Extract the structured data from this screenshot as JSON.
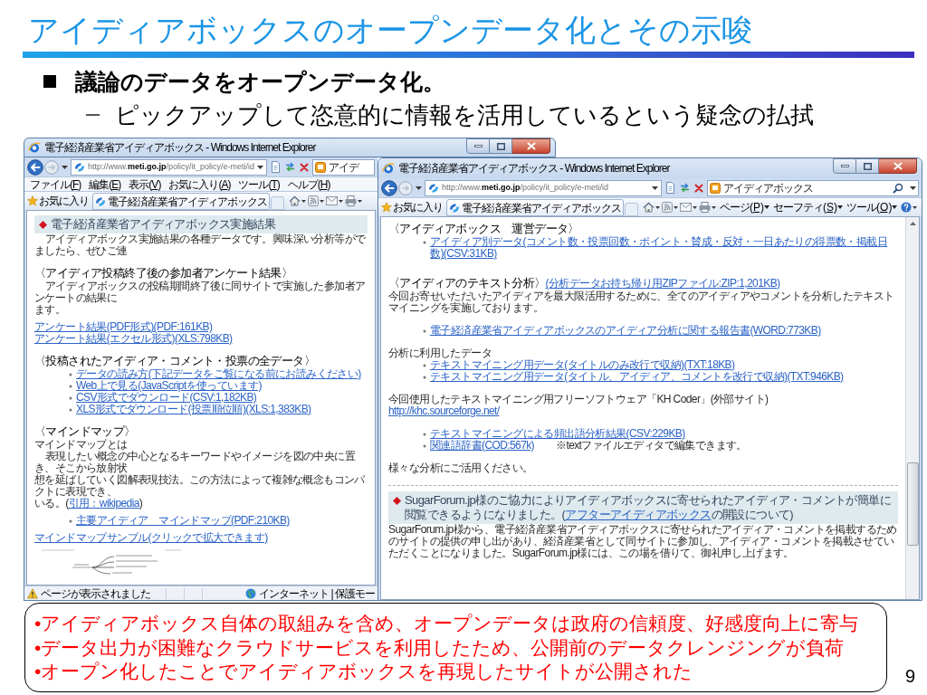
{
  "slide": {
    "title": "アイディアボックスのオープンデータ化とその示唆",
    "bullets": [
      {
        "text": "議論のデータをオープンデータ化。",
        "children": [
          {
            "text": "ピックアップして恣意的に情報を活用しているという疑念の払拭"
          }
        ]
      }
    ],
    "page_number": "9"
  },
  "screenshots": [
    {
      "partly_covered": true,
      "title": "電子経済産業省アイディアボックス - Windows Internet Explorer",
      "address": {
        "url": "http://www.**meti.go.jp**/policy/it_policy/e-meti/id"
      },
      "search": {
        "value": "アイデ"
      },
      "menu": [
        "ファイル(F)",
        "編集(E)",
        "表示(V)",
        "お気に入り(A)",
        "ツール(T)",
        "ヘルプ(H)"
      ],
      "favorites": {
        "label": "お気に入り"
      },
      "tabs": [
        {
          "label": "電子経済産業省アイディアボックス",
          "selected": true
        }
      ],
      "sections": [
        {
          "lines": [
            {
              "kind": "banner",
              "text": "電子経済産業省アイディアボックス実施結果"
            },
            {
              "kind": "text",
              "indent": true,
              "text": "アイディアボックス実施結果の各種データです。興味深い分析等がでましたら、ぜひご連"
            }
          ]
        },
        {
          "lines": [
            {
              "kind": "heading",
              "text": "〈アイディア投稿終了後の参加者アンケート結果〉"
            },
            {
              "kind": "text",
              "indent": true,
              "text": "アイディアボックスの投稿期間終了後に同サイトで実施した参加者アンケートの結果に"
            },
            {
              "kind": "text",
              "indent": false,
              "text": "ます。"
            }
          ]
        },
        {
          "lines": [
            {
              "kind": "link",
              "text": "アンケート結果(PDF形式)(PDF:161KB)"
            },
            {
              "kind": "link",
              "text": "アンケート結果(エクセル形式)(XLS:798KB)"
            }
          ]
        },
        {
          "lines": [
            {
              "kind": "heading",
              "text": "〈投稿されたアイディア・コメント・投票の全データ〉"
            },
            {
              "kind": "bullet_link",
              "text": "データの読み方(下記データをご覧になる前にお読みください)"
            },
            {
              "kind": "bullet_link",
              "text": "Web上で見る(JavaScriptを使っています)"
            },
            {
              "kind": "bullet_link",
              "text": "CSV形式でダウンロード(CSV:1,182KB)"
            },
            {
              "kind": "bullet_link",
              "text": "XLS形式でダウンロード(投票順位順)(XLS:1,383KB)"
            }
          ]
        },
        {
          "lines": [
            {
              "kind": "heading",
              "text": "〈マインドマップ〉"
            },
            {
              "kind": "text",
              "indent": false,
              "text": "マインドマップとは"
            },
            {
              "kind": "text",
              "indent": true,
              "text": "表現したい概念の中心となるキーワードやイメージを図の中央に置き、そこから放射状"
            },
            {
              "kind": "text",
              "indent": false,
              "text": "想を延ばしていく図解表現技法。この方法によって複雑な概念もコンパクトに表現でき、"
            },
            {
              "kind": "text",
              "indent": false,
              "text": "いる。(",
              "link": "引用：wikipedia",
              "text_after": ")"
            }
          ]
        },
        {
          "lines": [
            {
              "kind": "bullet_link",
              "text": "主要アイディア　マインドマップ(PDF:210KB)"
            }
          ]
        },
        {
          "lines": [
            {
              "kind": "link",
              "text": "マインドマップサンプル(クリックで拡大できます)"
            },
            {
              "kind": "thumbnail"
            }
          ]
        }
      ],
      "status_bar": {
        "message": "ページが表示されました",
        "zone": "インターネット | 保護モー"
      }
    },
    {
      "partly_covered": false,
      "title": "電子経済産業省アイディアボックス - Windows Internet Explorer",
      "address": {
        "url": "http://www.**meti.go.jp**/policy/it_policy/e-meti/id"
      },
      "search": {
        "value": "アイディアボックス"
      },
      "favorites": {
        "label": "お気に入り"
      },
      "tabs": [
        {
          "label": "電子経済産業省アイディアボックス",
          "selected": true
        }
      ],
      "commands": [
        "ページ(P)",
        "セーフティ(S)",
        "ツール(O)"
      ],
      "sections": [
        {
          "lines": [
            {
              "kind": "heading",
              "text": "〈アイディアボックス　運営データ〉"
            },
            {
              "kind": "bullet_link",
              "text": "アイディア別データ(コメント数・投票回数・ポイント・賛成・反対・一日あたりの得票数・掲載日数)(CSV:31KB)"
            }
          ]
        },
        {
          "lines": [
            {
              "kind": "heading",
              "text": "〈アイディアのテキスト分析〉",
              "link": "(分析データお持ち帰り用ZIPファイル:ZIP:1,201KB)"
            },
            {
              "kind": "text",
              "indent": false,
              "text": "今回お寄せいただいたアイディアを最大限活用するために、全てのアイディアやコメントを分析したテキストマイニングを実施しております。"
            }
          ]
        },
        {
          "lines": [
            {
              "kind": "bullet_link",
              "text": "電子経済産業省アイディアボックスのアイディア分析に関する報告書(WORD:773KB)"
            }
          ]
        },
        {
          "lines": [
            {
              "kind": "text",
              "indent": false,
              "text": "分析に利用したデータ"
            },
            {
              "kind": "bullet_link",
              "text": "テキストマイニング用データ(タイトルのみ改行で収納)(TXT:18KB)"
            },
            {
              "kind": "bullet_link",
              "text": "テキストマイニング用データ(タイトル、アイディア、コメントを改行で収納)(TXT:946KB)"
            }
          ]
        },
        {
          "lines": [
            {
              "kind": "text",
              "indent": false,
              "text": "今回使用したテキストマイニング用フリーソフトウェア「KH Coder」(外部サイト)"
            },
            {
              "kind": "link",
              "text": "http://khc.sourceforge.net/"
            }
          ]
        },
        {
          "lines": [
            {
              "kind": "bullet_link",
              "text": "テキストマイニングによる頻出語分析結果(CSV:229KB)"
            },
            {
              "kind": "bullet_link",
              "text": "関連語辞書(COD:567k)",
              "note": "※textファイルエディタで編集できます。"
            }
          ]
        },
        {
          "lines": [
            {
              "kind": "text",
              "indent": false,
              "text": "様々な分析にご活用ください。"
            }
          ]
        },
        {
          "lines": [
            {
              "kind": "rule"
            },
            {
              "kind": "banner",
              "text": "SugarForum.jp様のご協力によりアイディアボックスに寄せられたアイディア・コメントが簡単に閲覧できるようになりました。(",
              "link": "アフターアイディアボックス",
              "text_after": "の開設について)"
            },
            {
              "kind": "text",
              "indent": false,
              "text": "SugarForum.jp様から、電子経済産業省アイディアボックスに寄せられたアイディア・コメントを掲載するためのサイトの提供の申し出があり、経済産業省として同サイトに参加し、アイディア・コメントを掲載させていただくことになりました。SugarForum.jp様には、この場を借りて、御礼申し上げます。"
            }
          ]
        }
      ]
    }
  ],
  "callout": {
    "lines": [
      "•アイディアボックス自体の取組みを含め、オープンデータは政府の信頼度、好感度向上に寄与",
      "•データ出力が困難なクラウドサービスを利用したため、公開前のデータクレンジングが負荷",
      "•オープン化したことでアイディアボックスを再現したサイトが公開された"
    ]
  }
}
